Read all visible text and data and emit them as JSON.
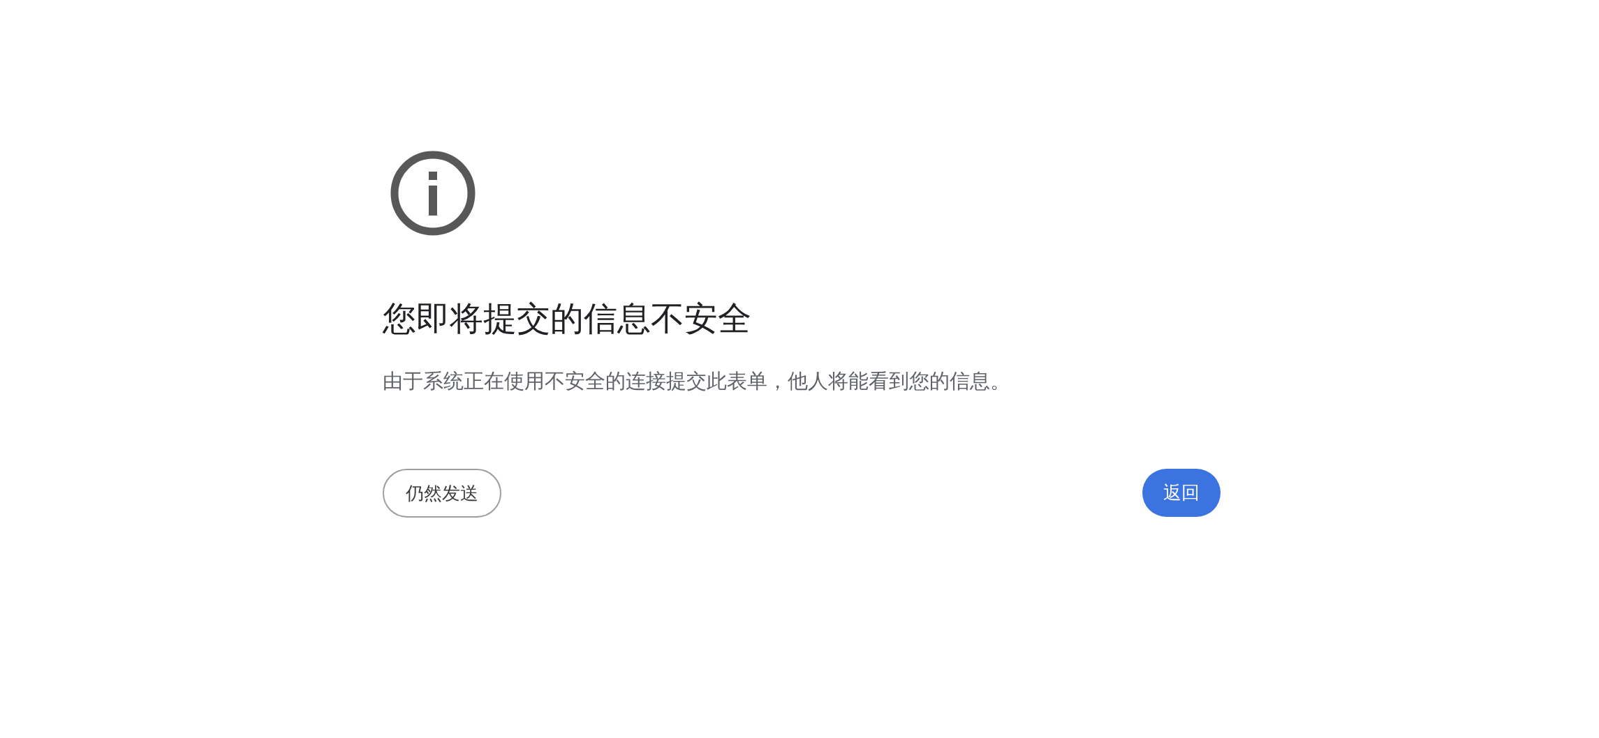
{
  "title": "您即将提交的信息不安全",
  "message": "由于系统正在使用不安全的连接提交此表单，他人将能看到您的信息。",
  "buttons": [
    {
      "label": "仍然发送",
      "kind": "secondary"
    },
    {
      "label": "返回",
      "kind": "primary"
    }
  ]
}
